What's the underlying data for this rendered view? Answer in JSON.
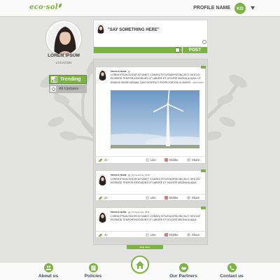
{
  "header": {
    "logo_text": "eco·sol",
    "profile_name": "PROFILE NAME",
    "avatar_initials": "KD"
  },
  "sidebar": {
    "name": "LOREM IPSUM",
    "location": "LOCATION",
    "trending_label": "Trending",
    "all_updates_label": "All Updates"
  },
  "composer": {
    "placeholder": "\"SAY SOMETHING HERE\"",
    "post_label": "POST"
  },
  "posts": [
    {
      "name": "PROFILE NAME",
      "date": "",
      "text": "LOREM IPSUM DOLOR SIT AMET, CONSECTETUR ADIPISCING ELIT, SED DO EIUSMOD TEMPOR INCIDIDUNT UT LABORE ET DOLORE MAGNA ALIQUA. UT ENIM AD MINIM VENIAM, QUIS NOSTRU D EXERCITATION ULLAMCO.",
      "more": "..see more",
      "likes": "22",
      "like_label": "Like",
      "dislike_label": "Dislike",
      "share_label": "Share"
    },
    {
      "name": "PROFILE NAME",
      "date": "14 November, 2016",
      "text": "LOREM IPSUM DOLOR SIT AMET, CONSECTETUR ADIPISCING ELIT, SED DO EIUSMOD TEMPOR INCIDIDUNT UT LABORE ET DOLORE MAGNA ALIQUA.",
      "likes": "22",
      "like_label": "Like",
      "dislike_label": "Dislike",
      "share_label": "Share"
    },
    {
      "name": "PROFILE NAME",
      "date": "14 November, 2016",
      "text": "LOREM IPSUM DOLOR SIT AMET, CONSECTETUR ADIPISCING ELIT, SED DO EIUSMOD TEMPOR INCIDIDUNT UT LABORE ET DOLORE MAGNA ALIQUA.",
      "likes": "22",
      "like_label": "Like",
      "dislike_label": "Dislike",
      "share_label": "Share"
    }
  ],
  "feed": {
    "view_more_label": "view more"
  },
  "footer": {
    "items": [
      {
        "label": "About us",
        "icon": "people-icon"
      },
      {
        "label": "Policies",
        "icon": "document-icon"
      },
      {
        "label": "Our Partners",
        "icon": "handshake-icon"
      },
      {
        "label": "Contact us",
        "icon": "phone-icon"
      }
    ],
    "home_icon": "home-icon"
  },
  "colors": {
    "accent": "#7cb342",
    "background": "#e3e4e2",
    "footer_text": "#3f4c63"
  }
}
